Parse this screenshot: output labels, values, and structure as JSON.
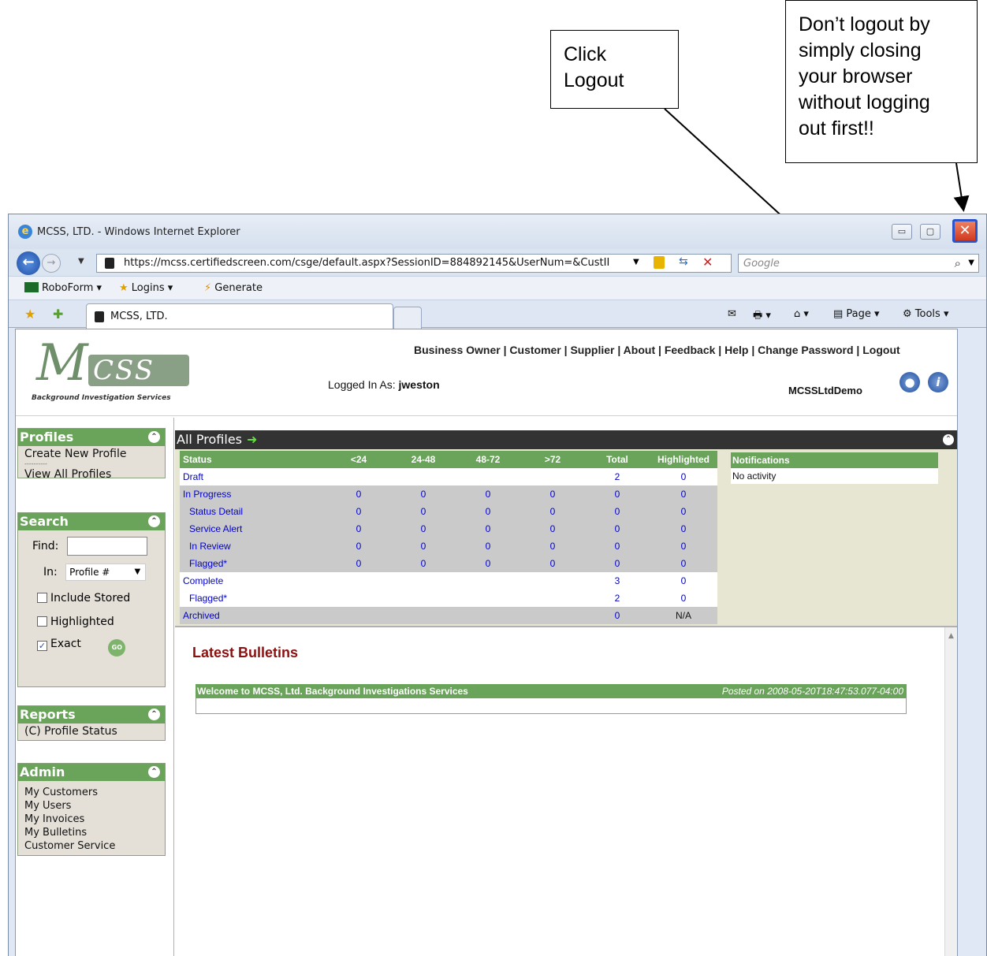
{
  "callouts": {
    "click_logout": "Click\nLogout",
    "dont_close": "Don’t logout by\nsimply closing\nyour browser\nwithout logging\nout first!!"
  },
  "browser": {
    "title": "MCSS, LTD. - Windows Internet Explorer",
    "url": "https://mcss.certifiedscreen.com/csge/default.aspx?SessionID=884892145&UserNum=&CustII",
    "search_placeholder": "Google",
    "toolbar": {
      "roboform": "RoboForm",
      "logins": "Logins",
      "generate": "Generate"
    },
    "tab_title": "MCSS, LTD.",
    "page_menu": "Page",
    "tools_menu": "Tools"
  },
  "header": {
    "logo_text": "CSS",
    "logo_sub": "Background Investigation Services",
    "links": [
      "Business Owner",
      "Customer",
      "Supplier",
      "About",
      "Feedback",
      "Help",
      "Change Password",
      "Logout"
    ],
    "logged_in_label": "Logged In As:",
    "username": "jweston",
    "account": "MCSSLtdDemo"
  },
  "sidebar": {
    "profiles": {
      "title": "Profiles",
      "items": [
        "Create New Profile",
        "----------",
        "View All Profiles"
      ]
    },
    "search": {
      "title": "Search",
      "find_label": "Find:",
      "in_label": "In:",
      "in_value": "Profile #",
      "include_stored": "Include Stored",
      "highlighted": "Highlighted",
      "exact": "Exact",
      "go": "GO"
    },
    "reports": {
      "title": "Reports",
      "items": [
        "(C) Profile Status"
      ]
    },
    "admin": {
      "title": "Admin",
      "items": [
        "My Customers",
        "My Users",
        "My Invoices",
        "My Bulletins",
        "Customer Service"
      ]
    }
  },
  "main": {
    "all_profiles": "All Profiles",
    "columns": [
      "Status",
      "<24",
      "24-48",
      "48-72",
      ">72",
      "Total",
      "Highlighted"
    ],
    "rows": [
      {
        "label": "Draft",
        "vals": [
          "",
          "",
          "",
          "",
          "2",
          "0"
        ]
      },
      {
        "label": "In Progress",
        "vals": [
          "0",
          "0",
          "0",
          "0",
          "0",
          "0"
        ]
      },
      {
        "label": "Status Detail",
        "vals": [
          "0",
          "0",
          "0",
          "0",
          "0",
          "0"
        ]
      },
      {
        "label": "Service Alert",
        "vals": [
          "0",
          "0",
          "0",
          "0",
          "0",
          "0"
        ]
      },
      {
        "label": "In Review",
        "vals": [
          "0",
          "0",
          "0",
          "0",
          "0",
          "0"
        ]
      },
      {
        "label": "Flagged*",
        "vals": [
          "0",
          "0",
          "0",
          "0",
          "0",
          "0"
        ]
      },
      {
        "label": "Complete",
        "vals": [
          "",
          "",
          "",
          "",
          "3",
          "0"
        ]
      },
      {
        "label": "Flagged*",
        "vals": [
          "",
          "",
          "",
          "",
          "2",
          "0"
        ]
      },
      {
        "label": "Archived",
        "vals": [
          "",
          "",
          "",
          "",
          "0",
          "N/A"
        ]
      }
    ],
    "notifications": {
      "title": "Notifications",
      "body": "No activity"
    },
    "bulletins": {
      "title": "Latest Bulletins",
      "item_title": "Welcome to MCSS, Ltd. Background Investigations Services",
      "item_date": "Posted on 2008-05-20T18:47:53.077-04:00"
    }
  }
}
